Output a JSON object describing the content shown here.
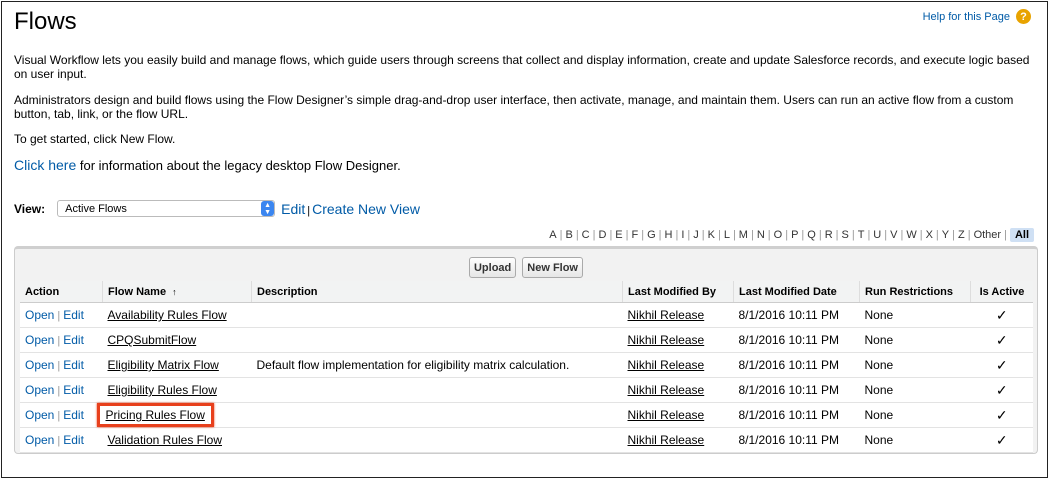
{
  "header": {
    "title": "Flows",
    "help_link": "Help for this Page",
    "help_icon": "question-icon"
  },
  "intro": {
    "p1": "Visual Workflow lets you easily build and manage flows, which guide users through screens that collect and display information, create and update Salesforce records, and execute logic based on user input.",
    "p2": "Administrators design and build flows using the Flow Designer’s simple drag-and-drop user interface, then activate, manage, and maintain them. Users can run an active flow from a custom button, tab, link, or the flow URL.",
    "p3": "To get started, click New Flow.",
    "p4_link": "Click here",
    "p4_text": " for information about the legacy desktop Flow Designer."
  },
  "view": {
    "label": "View:",
    "selected": "Active Flows",
    "edit_link": "Edit",
    "create_link": "Create New View"
  },
  "alpha_filter": {
    "letters": [
      "A",
      "B",
      "C",
      "D",
      "E",
      "F",
      "G",
      "H",
      "I",
      "J",
      "K",
      "L",
      "M",
      "N",
      "O",
      "P",
      "Q",
      "R",
      "S",
      "T",
      "U",
      "V",
      "W",
      "X",
      "Y",
      "Z",
      "Other"
    ],
    "selected": "All"
  },
  "buttons": {
    "upload": "Upload",
    "new_flow": "New Flow"
  },
  "table": {
    "columns": [
      "Action",
      "Flow Name",
      "Description",
      "Last Modified By",
      "Last Modified Date",
      "Run Restrictions",
      "Is Active"
    ],
    "sort_indicator": "↑",
    "action_open": "Open",
    "action_edit": "Edit",
    "rows": [
      {
        "name": "Availability Rules Flow",
        "description": "",
        "modified_by": "Nikhil Release",
        "modified_date": "8/1/2016 10:11 PM",
        "run_restrictions": "None",
        "is_active": "✓"
      },
      {
        "name": "CPQSubmitFlow",
        "description": "",
        "modified_by": "Nikhil Release",
        "modified_date": "8/1/2016 10:11 PM",
        "run_restrictions": "None",
        "is_active": "✓"
      },
      {
        "name": "Eligibility Matrix Flow",
        "description": "Default flow implementation for eligibility matrix calculation.",
        "modified_by": "Nikhil Release",
        "modified_date": "8/1/2016 10:11 PM",
        "run_restrictions": "None",
        "is_active": "✓"
      },
      {
        "name": "Eligibility Rules Flow",
        "description": "",
        "modified_by": "Nikhil Release",
        "modified_date": "8/1/2016 10:11 PM",
        "run_restrictions": "None",
        "is_active": "✓"
      },
      {
        "name": "Pricing Rules Flow",
        "description": "",
        "modified_by": "Nikhil Release",
        "modified_date": "8/1/2016 10:11 PM",
        "run_restrictions": "None",
        "is_active": "✓",
        "highlighted": true
      },
      {
        "name": "Validation Rules Flow",
        "description": "",
        "modified_by": "Nikhil Release",
        "modified_date": "8/1/2016 10:11 PM",
        "run_restrictions": "None",
        "is_active": "✓"
      }
    ]
  },
  "colors": {
    "link": "#015ba7",
    "highlight_border": "#e8401c",
    "help_icon_bg": "#e8a300",
    "select_arrow_bg": "#3b86f0"
  }
}
